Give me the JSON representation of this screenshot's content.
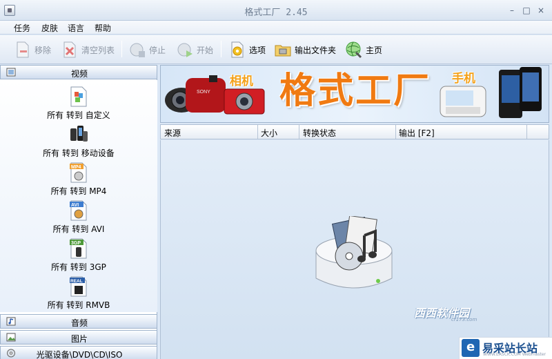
{
  "window": {
    "title": "格式工厂  2.45",
    "min_label": "–",
    "max_label": "□",
    "close_label": "×"
  },
  "menu": {
    "items": [
      "任务",
      "皮肤",
      "语言",
      "帮助"
    ]
  },
  "toolbar": {
    "remove": "移除",
    "clear": "清空列表",
    "stop": "停止",
    "start": "开始",
    "options": "选项",
    "output_folder": "输出文件夹",
    "home": "主页"
  },
  "sidebar": {
    "video_header": "视频",
    "video_items": [
      {
        "label": "所有 转到 自定义",
        "icon": "custom-format-icon"
      },
      {
        "label": "所有 转到 移动设备",
        "icon": "mobile-device-icon"
      },
      {
        "label": "所有 转到 MP4",
        "icon": "mp4-icon",
        "badge": "MP4"
      },
      {
        "label": "所有 转到 AVI",
        "icon": "avi-icon",
        "badge": "AVI"
      },
      {
        "label": "所有 转到 3GP",
        "icon": "3gp-icon",
        "badge": "3GP"
      },
      {
        "label": "所有 转到 RMVB",
        "icon": "rmvb-icon",
        "badge": "REAL"
      }
    ],
    "audio_header": "音频",
    "picture_header": "图片",
    "disc_header": "光驱设备\\DVD\\CD\\ISO"
  },
  "banner": {
    "title": "格式工厂",
    "tag_camera": "相机",
    "tag_phone": "手机",
    "camera_brand": "SONY"
  },
  "table": {
    "columns": [
      "来源",
      "大小",
      "转换状态",
      "输出 [F2]"
    ]
  },
  "watermarks": {
    "xixi": "西西软件园",
    "xixi_sub": "cr173.com",
    "site": "易采站长站",
    "site_sub": "WWW.EASCK.COM  Webmaster"
  },
  "colors": {
    "banner_title": "#f07a12",
    "accent_blue": "#1f66b3",
    "panel_bg": "#dce8f6"
  }
}
